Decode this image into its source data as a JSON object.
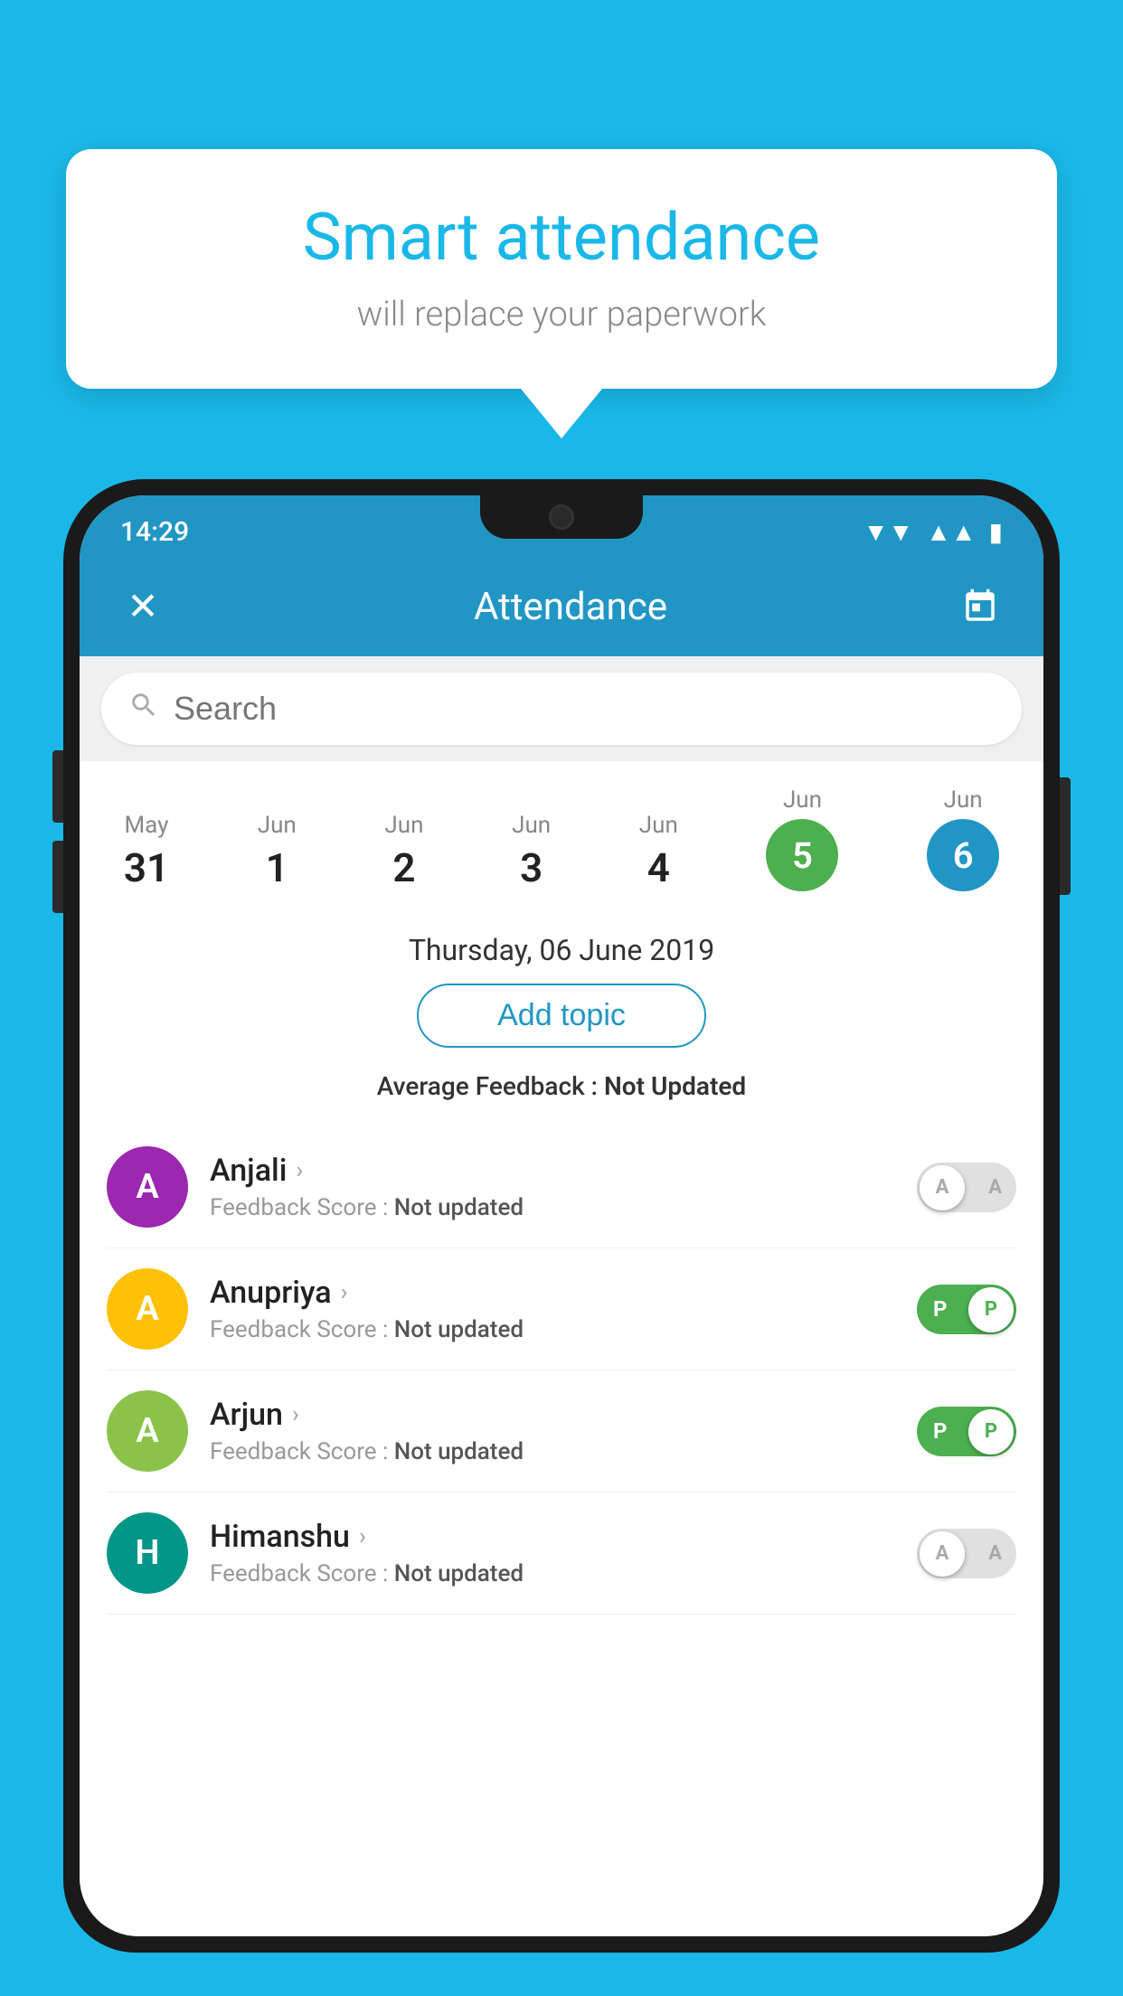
{
  "background_color": "#1ab8e8",
  "hero": {
    "title": "Smart attendance",
    "subtitle": "will replace your paperwork"
  },
  "status_bar": {
    "time": "14:29",
    "wifi": "▼",
    "signal": "▲",
    "battery": "▮"
  },
  "top_bar": {
    "close_label": "✕",
    "title": "Attendance",
    "calendar_icon": "📅"
  },
  "search": {
    "placeholder": "Search"
  },
  "calendar": {
    "days": [
      {
        "month": "May",
        "day": "31",
        "style": "normal"
      },
      {
        "month": "Jun",
        "day": "1",
        "style": "normal"
      },
      {
        "month": "Jun",
        "day": "2",
        "style": "normal"
      },
      {
        "month": "Jun",
        "day": "3",
        "style": "normal"
      },
      {
        "month": "Jun",
        "day": "4",
        "style": "normal"
      },
      {
        "month": "Jun",
        "day": "5",
        "style": "green"
      },
      {
        "month": "Jun",
        "day": "6",
        "style": "blue"
      }
    ]
  },
  "selected_date": "Thursday, 06 June 2019",
  "add_topic_label": "Add topic",
  "average_feedback": {
    "label": "Average Feedback : ",
    "value": "Not Updated"
  },
  "students": [
    {
      "name": "Anjali",
      "avatar_letter": "A",
      "avatar_color": "purple",
      "feedback_label": "Feedback Score : ",
      "feedback_value": "Not updated",
      "toggle": "off",
      "toggle_letter": "A"
    },
    {
      "name": "Anupriya",
      "avatar_letter": "A",
      "avatar_color": "yellow",
      "feedback_label": "Feedback Score : ",
      "feedback_value": "Not updated",
      "toggle": "on",
      "toggle_letter": "P"
    },
    {
      "name": "Arjun",
      "avatar_letter": "A",
      "avatar_color": "lightgreen",
      "feedback_label": "Feedback Score : ",
      "feedback_value": "Not updated",
      "toggle": "on",
      "toggle_letter": "P"
    },
    {
      "name": "Himanshu",
      "avatar_letter": "H",
      "avatar_color": "teal",
      "feedback_label": "Feedback Score : ",
      "feedback_value": "Not updated",
      "toggle": "off",
      "toggle_letter": "A"
    }
  ]
}
